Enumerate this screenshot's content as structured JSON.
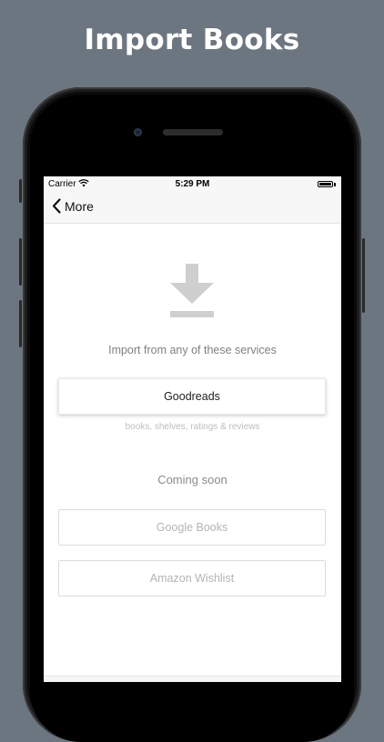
{
  "headline": "Import Books",
  "status_bar": {
    "carrier": "Carrier",
    "time": "5:29 PM"
  },
  "nav": {
    "back_label": "More"
  },
  "import": {
    "icon": "download-icon",
    "subtitle": "Import from any of these services",
    "primary_service": {
      "label": "Goodreads",
      "caption": "books, shelves, ratings & reviews"
    },
    "coming_soon_label": "Coming soon",
    "upcoming_services": [
      {
        "label": "Google Books"
      },
      {
        "label": "Amazon Wishlist"
      }
    ]
  },
  "colors": {
    "background": "#6b7680",
    "icon_gray": "#cfcfcf",
    "disabled_text": "#b4b4b4"
  }
}
